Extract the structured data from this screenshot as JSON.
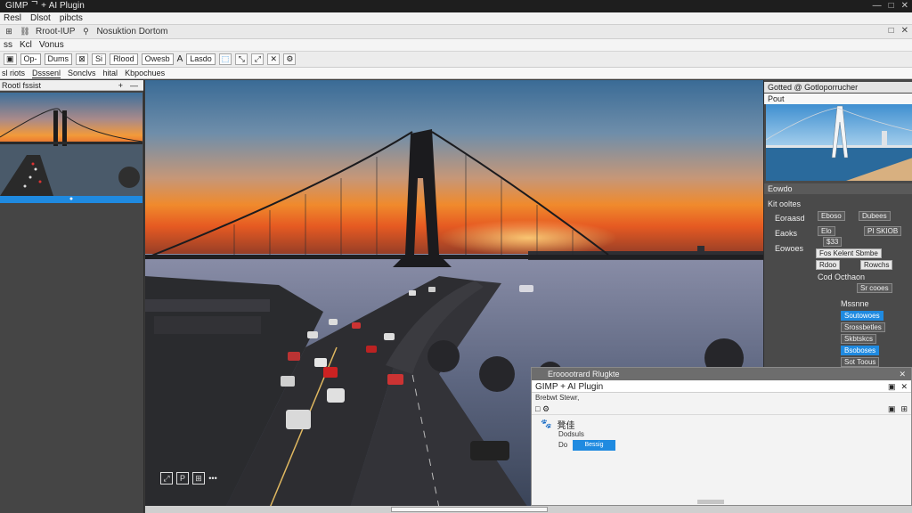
{
  "window": {
    "title": "GIMP ᄀ + AI Plugin",
    "controls": [
      "—",
      "□",
      "✕"
    ]
  },
  "menu": {
    "items": [
      "Resl",
      "Dlsot",
      "pibcts"
    ]
  },
  "row1": {
    "label1": "Rroot-IUP",
    "label2": "Nosuktion Dortom",
    "right_tools": [
      "□",
      "✕"
    ]
  },
  "row2": {
    "items": [
      "ss",
      "Kcl",
      "Vonus"
    ]
  },
  "tool_options": {
    "op": "Op-",
    "dums": "Dums",
    "seg": "Si",
    "rlood": "Rlood",
    "owesb": "Owesb",
    "letter_a": "A",
    "lasdo": "Lasdo"
  },
  "tabs": {
    "items": [
      "sl riots",
      "Dsssenl",
      "Sonclvs",
      "hital",
      "Kbpochues"
    ]
  },
  "left_panel": {
    "title": "Rootl fssist",
    "controls": [
      "+",
      "—"
    ],
    "selection_marker": "●"
  },
  "right_panel": {
    "header": "Gotted @ Gotloporrucher",
    "thumb_label": "Pout",
    "section1": "Eowdo",
    "section2": "Kit ooltes",
    "rows": {
      "r1_label": "Eoraasd",
      "r1_box1": "Eboso",
      "r1_box2": "Dubees",
      "r2_label": "Eaoks",
      "r2_box1": "Elo",
      "r2_box2": "PI SKIOB",
      "r2_sub": "$33",
      "r3_label": "Eowoes",
      "r3_box": "Fos Kelent Sbmbe",
      "r4_box1": "Rdoo",
      "r4_box2": "Rowchs",
      "r5_label": "Cod Octhaon",
      "r5_box": "Sr cooes",
      "r6_label": "Mssnne",
      "r6_box": "Soutowoes",
      "r7_box": "Srossbetles",
      "r8_box": "Skbtskcs",
      "r9_box": "Bsoboses",
      "r10_box": "Sot Toous"
    }
  },
  "plugin": {
    "outer_title": "Erooootrard Rlugkte",
    "title": "GIMP + AI Plugin",
    "subtitle": "Brebwt Stewr,",
    "cjk_text": "凳佳",
    "label": "Dodsuls",
    "button_label": "Do",
    "button_text": "Bessig"
  },
  "canvas_tools": [
    "⤢",
    "P",
    "⊞",
    "•••"
  ],
  "colors": {
    "accent": "#1f8ae0",
    "sky_top": "#3a6b96",
    "sunset": "#f08a2c"
  }
}
